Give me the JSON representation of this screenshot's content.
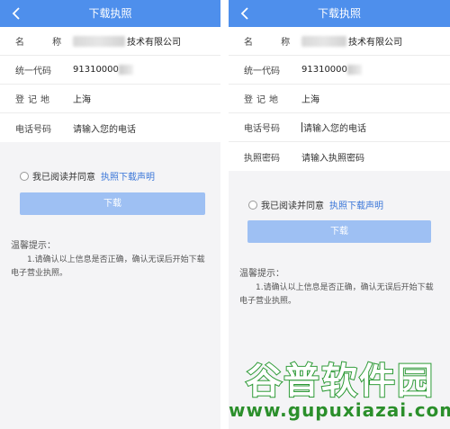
{
  "left": {
    "header": {
      "title": "下载执照"
    },
    "fields": [
      {
        "label": "名  称",
        "value": "技术有限公司"
      },
      {
        "label": "统一代码",
        "value": "91310000"
      },
      {
        "label": "登记地",
        "value": "上海"
      },
      {
        "label": "电话号码",
        "placeholder": "请输入您的电话"
      }
    ],
    "agree": {
      "text": "我已阅读并同意",
      "link": "执照下载声明"
    },
    "download_label": "下载",
    "tips": {
      "title": "温馨提示：",
      "line1": "1.请确认以上信息是否正确，确认无误后开始下载",
      "line2": "电子营业执照。"
    }
  },
  "right": {
    "header": {
      "title": "下载执照"
    },
    "fields": [
      {
        "label": "名  称",
        "value": "技术有限公司"
      },
      {
        "label": "统一代码",
        "value": "91310000"
      },
      {
        "label": "登记地",
        "value": "上海"
      },
      {
        "label": "电话号码",
        "placeholder": "请输入您的电话"
      },
      {
        "label": "执照密码",
        "placeholder": "请输入执照密码"
      }
    ],
    "agree": {
      "text": "我已阅读并同意",
      "link": "执照下载声明"
    },
    "download_label": "下载",
    "tips": {
      "title": "温馨提示：",
      "line1": "1.请确认以上信息是否正确，确认无误后开始下载",
      "line2": "电子营业执照。"
    }
  },
  "watermark": {
    "brand": "谷普软件园",
    "url": "www.gupuxiazai.com"
  },
  "icons": {
    "back": "chevron-left-icon",
    "radio": "radio-icon"
  },
  "colors": {
    "header": "#4e8fec",
    "button": "#9ec0f3",
    "link": "#3a76d8",
    "watermark": "#2d9a36"
  }
}
